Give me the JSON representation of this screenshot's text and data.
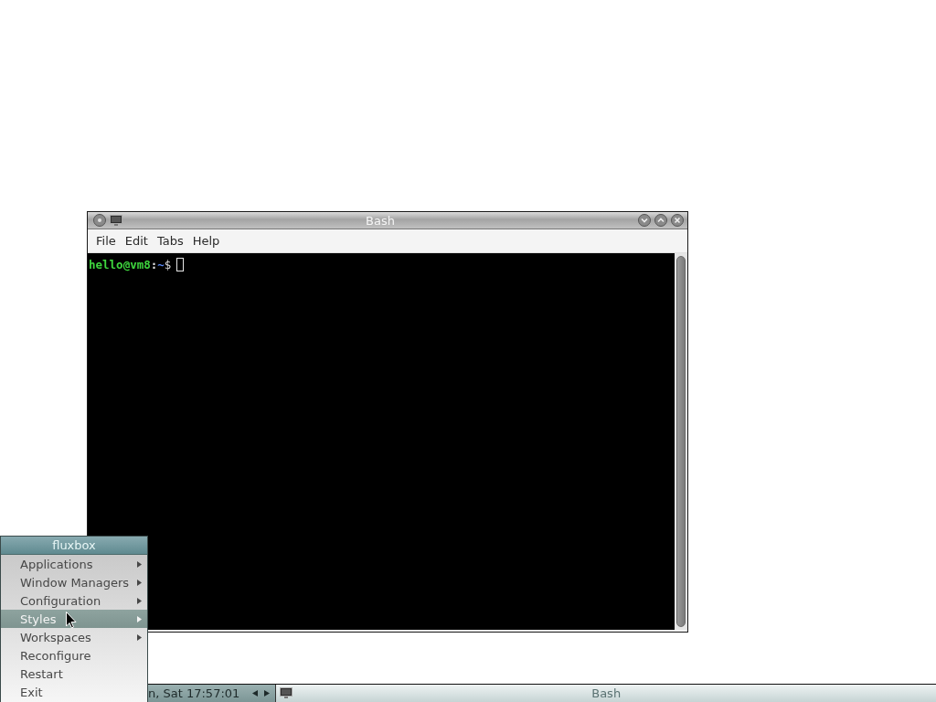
{
  "window": {
    "title": "Bash",
    "menu_bar": [
      "File",
      "Edit",
      "Tabs",
      "Help"
    ],
    "terminal": {
      "prompt": {
        "user_host": "hello@vm8",
        "separator": ":",
        "path": "~",
        "symbol": "$"
      }
    }
  },
  "root_menu": {
    "title": "fluxbox",
    "items": [
      {
        "label": "Applications",
        "selected": false,
        "has_submenu": true
      },
      {
        "label": "Window Managers",
        "selected": false,
        "has_submenu": true
      },
      {
        "label": "Configuration",
        "selected": false,
        "has_submenu": true
      },
      {
        "label": "Styles",
        "selected": true,
        "has_submenu": true
      },
      {
        "label": "Workspaces",
        "selected": false,
        "has_submenu": true
      },
      {
        "label": "Reconfigure",
        "selected": false,
        "has_submenu": false
      },
      {
        "label": "Restart",
        "selected": false,
        "has_submenu": false
      },
      {
        "label": "Exit",
        "selected": false,
        "has_submenu": false
      }
    ]
  },
  "taskbar": {
    "clock": "n, Sat 17:57:01",
    "tasks": [
      {
        "title": "Bash"
      }
    ]
  }
}
